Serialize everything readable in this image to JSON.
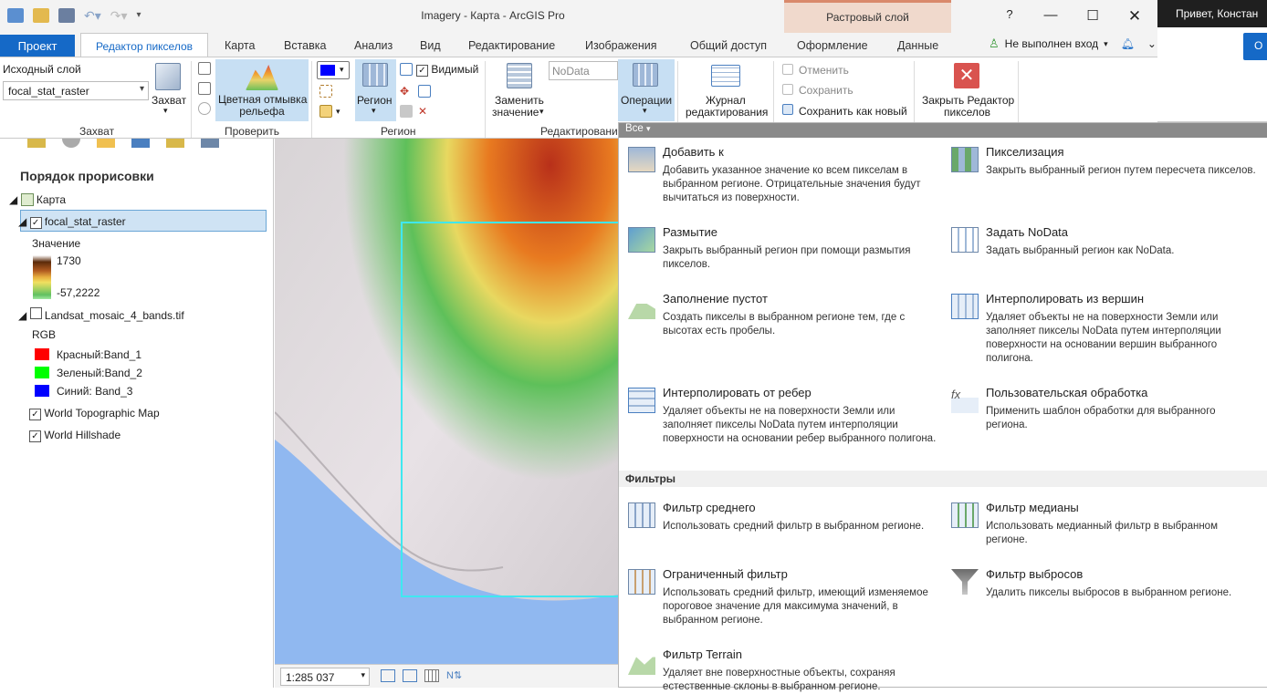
{
  "window": {
    "title": "Imagery - Карта - ArcGIS Pro",
    "context_tab_group": "Растровый слой",
    "help": "?",
    "user": "Привет, Констан"
  },
  "tabs": [
    "Проект",
    "Редактор пикселов",
    "Карта",
    "Вставка",
    "Анализ",
    "Вид",
    "Редактирование",
    "Изображения",
    "Общий доступ",
    "Оформление",
    "Данные"
  ],
  "signin": "Не выполнен вход",
  "ribbon": {
    "source_layer_label": "Исходный слой",
    "source_layer_value": "focal_stat_raster",
    "capture_button": "Захват",
    "capture_group": "Захват",
    "hillshade_line1": "Цветная отмывка",
    "hillshade_line2": "рельефа",
    "check_group": "Проверить",
    "visible_label": "Видимый",
    "region_button": "Регион",
    "region_group": "Регион",
    "replace_line1": "Заменить",
    "replace_line2": "значение",
    "nodata_placeholder": "NoData",
    "operations_button": "Операции",
    "editing_group": "Редактирование",
    "journal_line1": "Журнал",
    "journal_line2": "редактирования",
    "undo": "Отменить",
    "save": "Сохранить",
    "save_as_new": "Сохранить как новый",
    "close_line1": "Закрыть Редактор",
    "close_line2": "пикселов"
  },
  "contents": {
    "heading": "Порядок прорисовки",
    "map": "Карта",
    "layer1": "focal_stat_raster",
    "value_label": "Значение",
    "max_value": "1730",
    "min_value": "-57,2222",
    "layer2": "Landsat_mosaic_4_bands.tif",
    "rgb": "RGB",
    "red": "Красный:Band_1",
    "green": "Зеленый:Band_2",
    "blue": "Синий: Band_3",
    "layer3": "World Topographic Map",
    "layer4": "World Hillshade"
  },
  "status": {
    "scale": "1:285 037"
  },
  "operations": {
    "filter_label": "Все",
    "filters_section": "Фильтры",
    "items": [
      {
        "title": "Добавить к",
        "desc": "Добавить указанное значение ко всем пикселам в выбранном регионе. Отрицательные значения будут вычитаться из поверхности."
      },
      {
        "title": "Пикселизация",
        "desc": "Закрыть выбранный регион путем пересчета пикселов."
      },
      {
        "title": "Размытие",
        "desc": "Закрыть выбранный регион при помощи размытия пикселов."
      },
      {
        "title": "Задать NoData",
        "desc": "Задать выбранный регион как NoData."
      },
      {
        "title": "Заполнение пустот",
        "desc": "Создать пикселы в выбранном регионе тем,  где с высотах есть пробелы."
      },
      {
        "title": "Интерполировать из вершин",
        "desc": "Удаляет объекты не на поверхности Земли или заполняет пикселы NoData путем интерполяции поверхности на основании вершин выбранного полигона."
      },
      {
        "title": "Интерполировать от ребер",
        "desc": "Удаляет объекты не на поверхности Земли или заполняет пикселы NoData путем интерполяции поверхности на основании ребер выбранного полигона."
      },
      {
        "title": "Пользовательская обработка",
        "desc": "Применить шаблон обработки для выбранного региона."
      }
    ],
    "filters": [
      {
        "title": "Фильтр среднего",
        "desc": "Использовать средний фильтр в выбранном регионе."
      },
      {
        "title": "Фильтр медианы",
        "desc": "Использовать медианный фильтр в выбранном регионе."
      },
      {
        "title": "Ограниченный фильтр",
        "desc": "Использовать средний фильтр, имеющий изменяемое пороговое значение для максимума значений, в выбранном регионе."
      },
      {
        "title": "Фильтр выбросов",
        "desc": "Удалить пикселы выбросов в выбранном регионе."
      },
      {
        "title": "Фильтр Terrain",
        "desc": "Удаляет вне поверхностные объекты, сохраняя естественные склоны в выбранном регионе."
      }
    ]
  },
  "colors": {
    "accent": "#1569c7",
    "context_band": "#f0d9cc",
    "highlight": "#c7dff3",
    "close_red": "#d9534f"
  }
}
